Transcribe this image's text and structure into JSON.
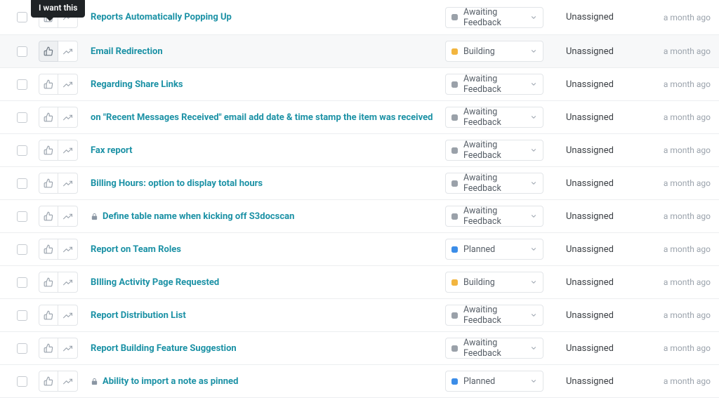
{
  "tooltip": "I want this",
  "status_labels": {
    "awaiting": "Awaiting Feedback",
    "building": "Building",
    "planned": "Planned"
  },
  "rows": [
    {
      "title": "Reports Automatically Popping Up",
      "status": "awaiting",
      "assignee": "Unassigned",
      "time": "a month ago",
      "locked": false,
      "highlight": false,
      "first": true,
      "showTooltip": true
    },
    {
      "title": "Email Redirection",
      "status": "building",
      "assignee": "Unassigned",
      "time": "a month ago",
      "locked": false,
      "highlight": true
    },
    {
      "title": "Regarding Share Links",
      "status": "awaiting",
      "assignee": "Unassigned",
      "time": "a month ago",
      "locked": false
    },
    {
      "title": "on \"Recent Messages Received\" email add date & time stamp the item was received",
      "status": "awaiting",
      "assignee": "Unassigned",
      "time": "a month ago",
      "locked": false
    },
    {
      "title": "Fax report",
      "status": "awaiting",
      "assignee": "Unassigned",
      "time": "a month ago",
      "locked": false
    },
    {
      "title": "Billing Hours: option to display total hours",
      "status": "awaiting",
      "assignee": "Unassigned",
      "time": "a month ago",
      "locked": false
    },
    {
      "title": "Define table name when kicking off S3docscan",
      "status": "awaiting",
      "assignee": "Unassigned",
      "time": "a month ago",
      "locked": true
    },
    {
      "title": "Report on Team Roles",
      "status": "planned",
      "assignee": "Unassigned",
      "time": "a month ago",
      "locked": false
    },
    {
      "title": "BIlling Activity Page Requested",
      "status": "building",
      "assignee": "Unassigned",
      "time": "a month ago",
      "locked": false
    },
    {
      "title": "Report Distribution List",
      "status": "awaiting",
      "assignee": "Unassigned",
      "time": "a month ago",
      "locked": false
    },
    {
      "title": "Report Building Feature Suggestion",
      "status": "awaiting",
      "assignee": "Unassigned",
      "time": "a month ago",
      "locked": false
    },
    {
      "title": "Ability to import a note as pinned",
      "status": "planned",
      "assignee": "Unassigned",
      "time": "a month ago",
      "locked": true
    }
  ]
}
